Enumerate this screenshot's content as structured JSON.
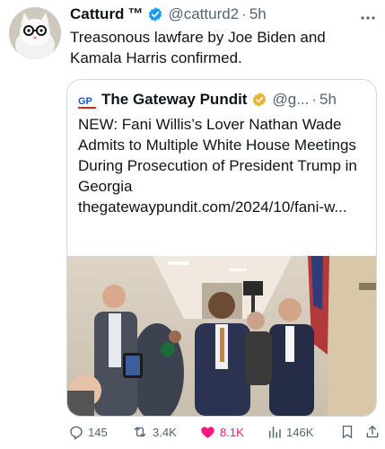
{
  "tweet": {
    "author_name": "Catturd",
    "author_tm": "™",
    "handle": "@catturd2",
    "separator": "·",
    "time": "5h",
    "text": "Treasonous lawfare by Joe Biden and Kamala Harris confirmed."
  },
  "quote": {
    "logo_text": "GP",
    "name": "The Gateway Pundit",
    "handle": "@g...",
    "separator": "·",
    "time": "5h",
    "text": "NEW: Fani Willis’s Lover Nathan Wade Admits to Multiple White House Meetings During Prosecution of President Trump in Georgia thegatewaypundit.com/2024/10/fani-w..."
  },
  "actions": {
    "replies": "145",
    "reposts": "3.4K",
    "likes": "8.1K",
    "views": "146K"
  },
  "icons": {
    "verified": "verified-badge-icon",
    "more": "more-dots-icon",
    "reply": "reply-icon",
    "repost": "repost-icon",
    "like": "heart-icon",
    "views": "views-chart-icon",
    "bookmark": "bookmark-icon",
    "share": "share-icon"
  },
  "colors": {
    "verified_gold": "#e8b339",
    "like_pink": "#f91880",
    "secondary_text": "#536471",
    "gp_blue": "#1a56c7"
  }
}
